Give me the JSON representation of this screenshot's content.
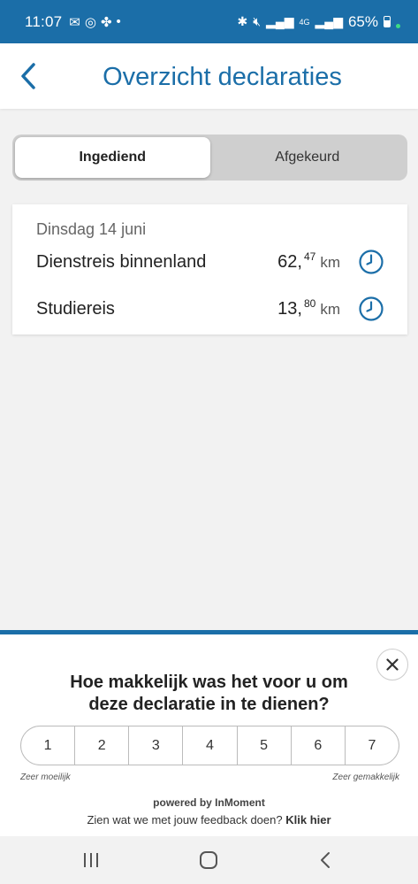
{
  "status_bar": {
    "time": "11:07",
    "battery": "65%",
    "network": "4G"
  },
  "header": {
    "title": "Overzicht declaraties"
  },
  "tabs": [
    {
      "label": "Ingediend",
      "active": true
    },
    {
      "label": "Afgekeurd",
      "active": false
    }
  ],
  "declaration_group": {
    "date": "Dinsdag 14 juni",
    "items": [
      {
        "label": "Dienstreis binnenland",
        "amount_int": "62,",
        "amount_dec": "47",
        "unit": "km",
        "status_icon": "clock-icon"
      },
      {
        "label": "Studiereis",
        "amount_int": "13,",
        "amount_dec": "80",
        "unit": "km",
        "status_icon": "clock-icon"
      }
    ]
  },
  "feedback": {
    "question": "Hoe makkelijk was het voor u om deze declaratie in te dienen?",
    "scale": [
      "1",
      "2",
      "3",
      "4",
      "5",
      "6",
      "7"
    ],
    "label_low": "Zeer moeilijk",
    "label_high": "Zeer gemakkelijk",
    "powered_by": "powered by InMoment",
    "link_prefix": "Zien wat we met jouw feedback doen?",
    "link_text": "Klik hier"
  },
  "colors": {
    "brand": "#1b6ea8",
    "background": "#f2f2f2"
  }
}
